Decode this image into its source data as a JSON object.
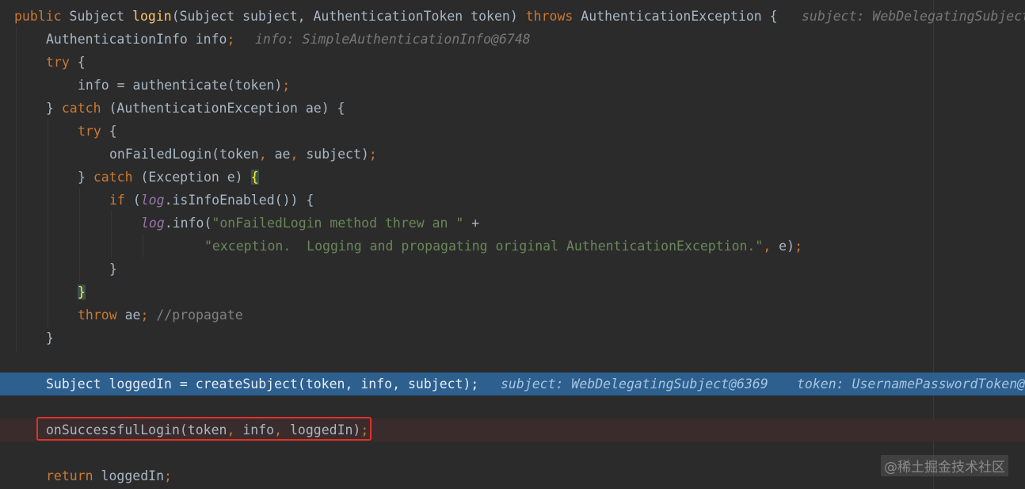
{
  "editor": {
    "lines": {
      "l1": {
        "kw_public": "public",
        "t_subject": " Subject ",
        "fn_login": "login",
        "params": "(Subject subject, AuthenticationToken token) ",
        "kw_throws": "throws",
        "t_exc": " AuthenticationException {",
        "hint": "subject: WebDelegatingSubject"
      },
      "l2": {
        "decl": "AuthenticationInfo info",
        "semi": ";",
        "hint": "info: SimpleAuthenticationInfo@6748"
      },
      "l3": {
        "kw_try": "try",
        "rest": " {"
      },
      "l4": {
        "stmt": "info = authenticate(token)",
        "semi": ";"
      },
      "l5": {
        "open": "} ",
        "kw_catch": "catch",
        "rest": " (AuthenticationException ae) {"
      },
      "l6": {
        "kw_try": "try",
        "rest": " {"
      },
      "l7": {
        "a": "onFailedLogin(token",
        "c1": ",",
        "b": " ae",
        "c2": ",",
        "d": " subject)",
        "semi": ";"
      },
      "l8": {
        "open": "} ",
        "kw_catch": "catch",
        "rest": " (Exception e) ",
        "brace": "{"
      },
      "l9": {
        "kw_if": "if",
        "p1": " (",
        "log": "log",
        "rest": ".isInfoEnabled()) {"
      },
      "l10": {
        "log": "log",
        "call": ".info(",
        "str": "\"onFailedLogin method threw an \"",
        "plus": " +"
      },
      "l11": {
        "str": "\"exception.  Logging and propagating original AuthenticationException.\"",
        "comma": ",",
        "rest": " e)",
        "semi": ";"
      },
      "l12": {
        "close": "}"
      },
      "l13": {
        "brace": "}"
      },
      "l14": {
        "kw_throw": "throw",
        "rest": " ae",
        "semi": ";",
        "comment": " //propagate"
      },
      "l15": {
        "close": "}"
      },
      "l16": {
        "stmt": "Subject loggedIn = createSubject(token, info, subject);",
        "hint1": "subject: WebDelegatingSubject@6369",
        "hint2": "token: UsernamePasswordToken@"
      },
      "l17": {
        "a": "onSuccessfulLogin(token",
        "c1": ",",
        "b": " info",
        "c2": ",",
        "d": " loggedIn)",
        "semi": ";"
      },
      "l18": {
        "kw_return": "return",
        "rest": " loggedIn",
        "semi": ";"
      }
    }
  },
  "watermark": "@稀土掘金技术社区",
  "colors": {
    "background": "#2b2b2b",
    "keyword": "#cc7832",
    "function": "#ffc66d",
    "string": "#6a8759",
    "execution_line": "#2d5f8f",
    "highlight_box": "#e0312b"
  }
}
